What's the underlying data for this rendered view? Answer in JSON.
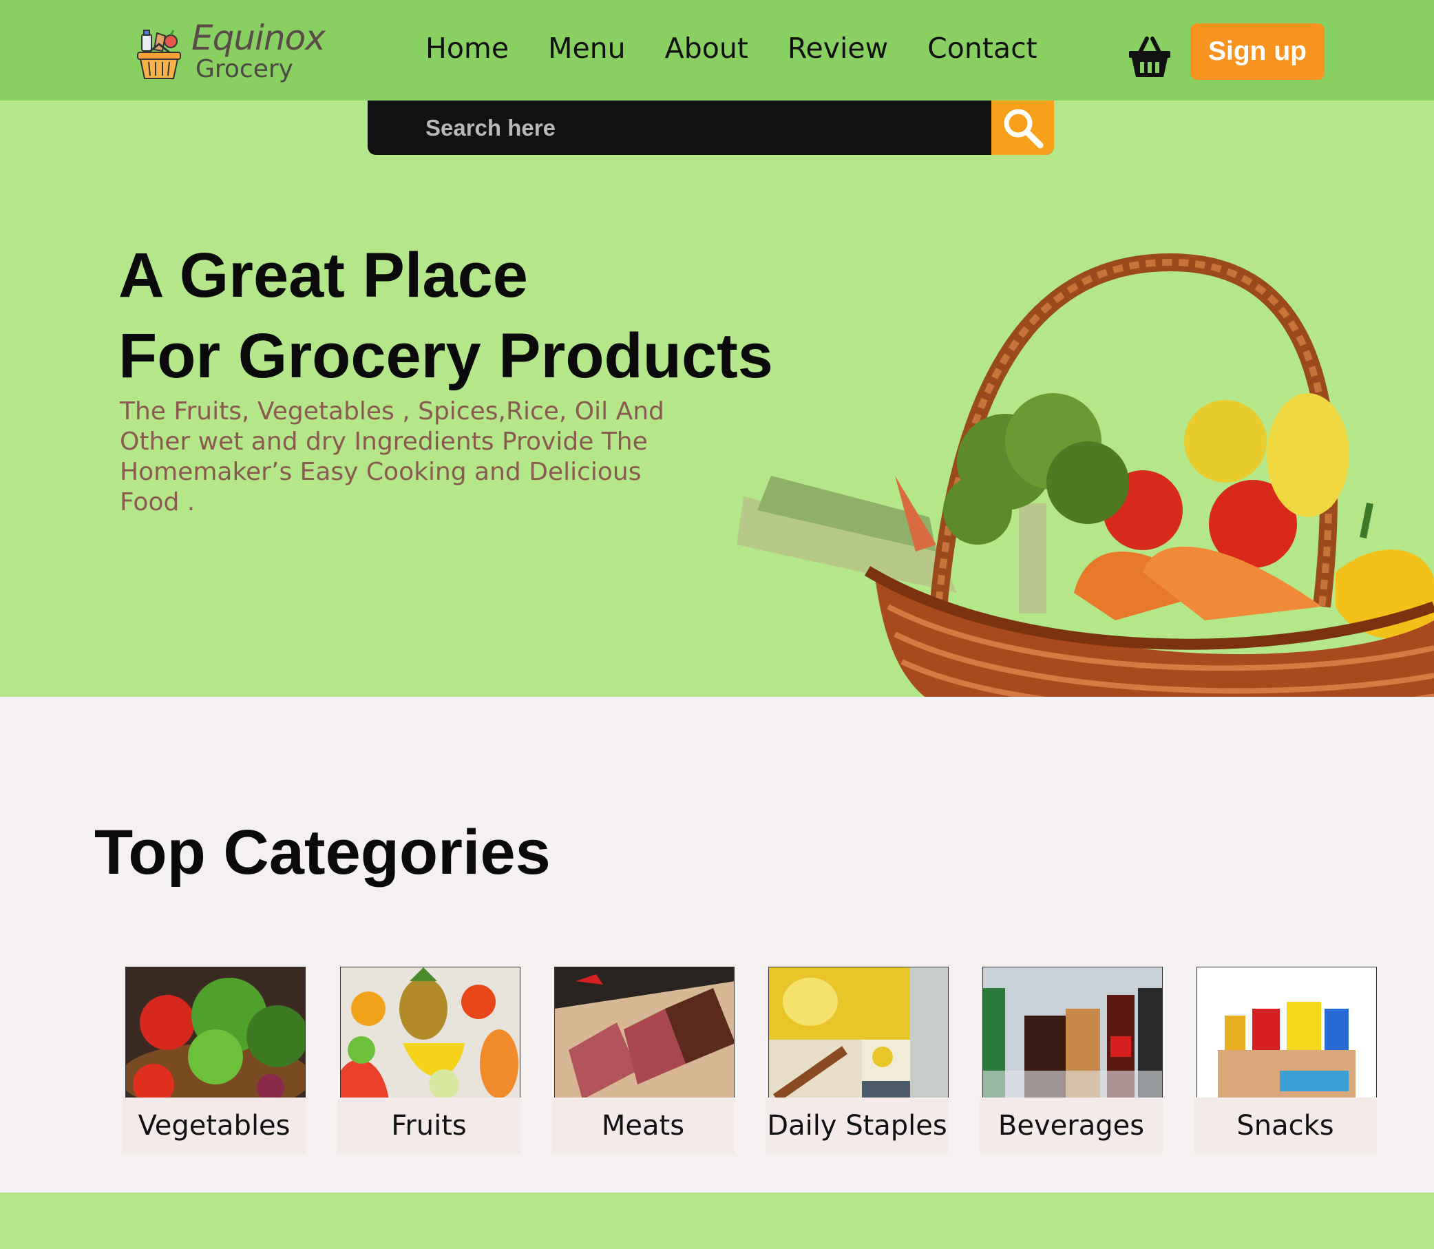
{
  "brand": {
    "name": "Equinox",
    "tagline": "Grocery",
    "icon": "grocery-basket-icon"
  },
  "nav": {
    "links": [
      "Home",
      "Menu",
      "About",
      "Review",
      "Contact"
    ],
    "cart_icon": "shopping-basket-icon",
    "signup_label": "Sign up"
  },
  "search": {
    "placeholder": "Search here",
    "button_icon": "search-icon"
  },
  "hero": {
    "title_line1": "A Great Place",
    "title_line2": "For Grocery Products",
    "description": "The Fruits, Vegetables , Spices,Rice, Oil And Other wet and dry Ingredients Provide The Homemaker’s Easy Cooking and Delicious Food .",
    "image": "vegetable-basket-photo"
  },
  "categories": {
    "title": "Top Categories",
    "items": [
      {
        "label": "Vegetables",
        "image": "vegetables-photo"
      },
      {
        "label": "Fruits",
        "image": "fruits-photo"
      },
      {
        "label": "Meats",
        "image": "meats-photo"
      },
      {
        "label": "Daily Staples",
        "image": "daily-staples-photo"
      },
      {
        "label": "Beverages",
        "image": "beverages-photo"
      },
      {
        "label": "Snacks",
        "image": "snacks-photo"
      }
    ]
  },
  "colors": {
    "nav_bg": "#88d062",
    "hero_bg": "#b3e78a",
    "accent_orange": "#f7931e",
    "search_bg": "#111111",
    "section_bg": "#f5f1f1"
  }
}
